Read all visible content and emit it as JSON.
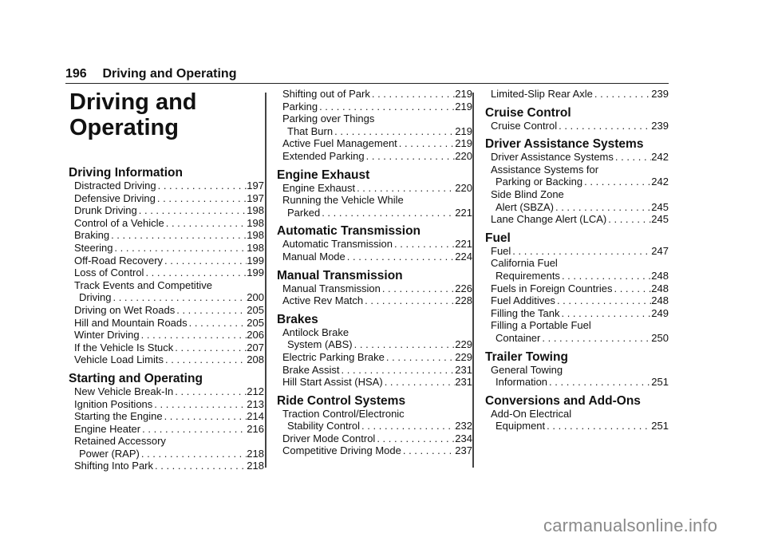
{
  "header": {
    "page_number": "196",
    "title": "Driving and Operating"
  },
  "chapter_title_line1": "Driving and",
  "chapter_title_line2": "Operating",
  "columns": [
    {
      "sections": [
        {
          "heading": "Driving Information",
          "entries": [
            {
              "label": "Distracted Driving",
              "page": "197"
            },
            {
              "label": "Defensive Driving",
              "page": "197"
            },
            {
              "label": "Drunk Driving",
              "page": "198"
            },
            {
              "label": "Control of a Vehicle",
              "page": "198"
            },
            {
              "label": "Braking",
              "page": "198"
            },
            {
              "label": "Steering",
              "page": "198"
            },
            {
              "label": "Off-Road Recovery",
              "page": "199"
            },
            {
              "label": "Loss of Control",
              "page": "199"
            },
            {
              "label_line1": "Track Events and Competitive",
              "label": "Driving",
              "page": "200"
            },
            {
              "label": "Driving on Wet Roads",
              "page": "205"
            },
            {
              "label": "Hill and Mountain Roads",
              "page": "205"
            },
            {
              "label": "Winter Driving",
              "page": "206"
            },
            {
              "label": "If the Vehicle Is Stuck",
              "page": "207"
            },
            {
              "label": "Vehicle Load Limits",
              "page": "208"
            }
          ]
        },
        {
          "heading": "Starting and Operating",
          "entries": [
            {
              "label": "New Vehicle Break-In",
              "page": "212"
            },
            {
              "label": "Ignition Positions",
              "page": "213"
            },
            {
              "label": "Starting the Engine",
              "page": "214"
            },
            {
              "label": "Engine Heater",
              "page": "216"
            },
            {
              "label_line1": "Retained Accessory",
              "label": "Power (RAP)",
              "page": "218"
            },
            {
              "label": "Shifting Into Park",
              "page": "218"
            }
          ]
        }
      ]
    },
    {
      "sections": [
        {
          "heading": "",
          "entries": [
            {
              "label": "Shifting out of Park",
              "page": "219"
            },
            {
              "label": "Parking",
              "page": "219"
            },
            {
              "label_line1": "Parking over Things",
              "label": "That Burn",
              "page": "219"
            },
            {
              "label": "Active Fuel Management",
              "page": "219"
            },
            {
              "label": "Extended Parking",
              "page": "220"
            }
          ]
        },
        {
          "heading": "Engine Exhaust",
          "entries": [
            {
              "label": "Engine Exhaust",
              "page": "220"
            },
            {
              "label_line1": "Running the Vehicle While",
              "label": "Parked",
              "page": "221"
            }
          ]
        },
        {
          "heading": "Automatic Transmission",
          "entries": [
            {
              "label": "Automatic Transmission",
              "page": "221"
            },
            {
              "label": "Manual Mode",
              "page": "224"
            }
          ]
        },
        {
          "heading": "Manual Transmission",
          "entries": [
            {
              "label": "Manual Transmission",
              "page": "226"
            },
            {
              "label": "Active Rev Match",
              "page": "228"
            }
          ]
        },
        {
          "heading": "Brakes",
          "entries": [
            {
              "label_line1": "Antilock Brake",
              "label": "System (ABS)",
              "page": "229"
            },
            {
              "label": "Electric Parking Brake",
              "page": "229"
            },
            {
              "label": "Brake Assist",
              "page": "231"
            },
            {
              "label": "Hill Start Assist (HSA)",
              "page": "231"
            }
          ]
        },
        {
          "heading": "Ride Control Systems",
          "entries": [
            {
              "label_line1": "Traction Control/Electronic",
              "label": "Stability Control",
              "page": "232"
            },
            {
              "label": "Driver Mode Control",
              "page": "234"
            },
            {
              "label": "Competitive Driving Mode",
              "page": "237"
            }
          ]
        }
      ]
    },
    {
      "sections": [
        {
          "heading": "",
          "entries": [
            {
              "label": "Limited-Slip Rear Axle",
              "page": "239"
            }
          ]
        },
        {
          "heading": "Cruise Control",
          "entries": [
            {
              "label": "Cruise Control",
              "page": "239"
            }
          ]
        },
        {
          "heading": "Driver Assistance Systems",
          "entries": [
            {
              "label": "Driver Assistance Systems",
              "page": "242"
            },
            {
              "label_line1": "Assistance Systems for",
              "label": "Parking or Backing",
              "page": "242"
            },
            {
              "label_line1": "Side Blind Zone",
              "label": "Alert (SBZA)",
              "page": "245"
            },
            {
              "label": "Lane Change Alert (LCA)",
              "page": "245"
            }
          ]
        },
        {
          "heading": "Fuel",
          "entries": [
            {
              "label": "Fuel",
              "page": "247"
            },
            {
              "label_line1": "California Fuel",
              "label": "Requirements",
              "page": "248"
            },
            {
              "label": "Fuels in Foreign Countries",
              "page": "248"
            },
            {
              "label": "Fuel Additives",
              "page": "248"
            },
            {
              "label": "Filling the Tank",
              "page": "249"
            },
            {
              "label_line1": "Filling a Portable Fuel",
              "label": "Container",
              "page": "250"
            }
          ]
        },
        {
          "heading": "Trailer Towing",
          "entries": [
            {
              "label_line1": "General Towing",
              "label": "Information",
              "page": "251"
            }
          ]
        },
        {
          "heading": "Conversions and Add-Ons",
          "entries": [
            {
              "label_line1": "Add-On Electrical",
              "label": "Equipment",
              "page": "251"
            }
          ]
        }
      ]
    }
  ],
  "watermark": "carmanualsonline.info"
}
